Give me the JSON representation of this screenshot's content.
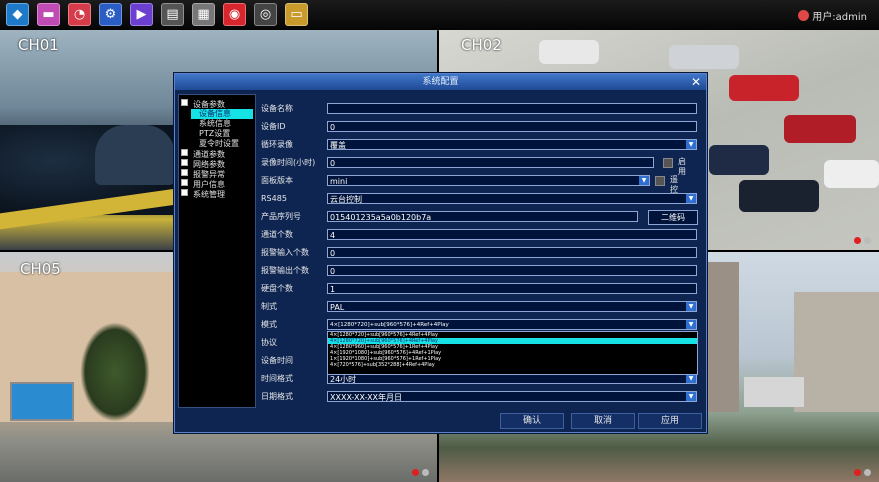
{
  "toolbar": {
    "icons": [
      {
        "name": "logo-icon",
        "glyph": "◆",
        "color": "#1e7ac9"
      },
      {
        "name": "picture-icon",
        "glyph": "▬",
        "color": "#c04bb5"
      },
      {
        "name": "chart-icon",
        "glyph": "◔",
        "color": "#d63b49"
      },
      {
        "name": "settings-icon",
        "glyph": "⚙",
        "color": "#2a5ec4"
      },
      {
        "name": "play-icon",
        "glyph": "▶",
        "color": "#6b3fd0"
      },
      {
        "name": "archive-icon",
        "glyph": "▤",
        "color": "#555555"
      },
      {
        "name": "keyboard-icon",
        "glyph": "▦",
        "color": "#777777"
      },
      {
        "name": "disk-icon",
        "glyph": "◉",
        "color": "#d8262e"
      },
      {
        "name": "camera-icon",
        "glyph": "◎",
        "color": "#444444"
      },
      {
        "name": "folder-icon",
        "glyph": "▭",
        "color": "#c99a2c"
      }
    ],
    "user_label": "用户:admin"
  },
  "cameras": {
    "ch01": "CH01",
    "ch02": "CH02",
    "ch05": "CH05"
  },
  "dialog": {
    "title": "系统配置",
    "tree": {
      "device_params": "设备参数",
      "device_info": "设备信息",
      "system_info": "系统信息",
      "ptz_settings": "PTZ设置",
      "dst_settings": "夏令时设置",
      "channel_params": "通道参数",
      "network_params": "网络参数",
      "alarm_exception": "报警异常",
      "user_info": "用户信息",
      "system_management": "系统管理"
    },
    "fields": {
      "device_name_label": "设备名称",
      "device_name_value": "",
      "device_id_label": "设备ID",
      "device_id_value": "0",
      "loop_record_label": "循环录像",
      "loop_record_value": "覆盖",
      "record_time_label": "录像时间(小时)",
      "record_time_value": "0",
      "record_time_enable": "启用",
      "panel_version_label": "面板版本",
      "panel_version_value": "mini",
      "remote_controller": "遥控器",
      "rs485_label": "RS485",
      "rs485_value": "云台控制",
      "serial_label": "产品序列号",
      "serial_value": "015401235a5a0b120b7a",
      "qr_button": "二维码",
      "channels_label": "通道个数",
      "channels_value": "4",
      "alarm_in_label": "报警输入个数",
      "alarm_in_value": "0",
      "alarm_out_label": "报警输出个数",
      "alarm_out_value": "0",
      "hdd_label": "硬盘个数",
      "hdd_value": "1",
      "standard_label": "制式",
      "standard_value": "PAL",
      "mode_label": "模式",
      "mode_value": "4×[1280*720]+sub[960*576]+4Ref+4Play",
      "protocol_label": "协议",
      "device_time_label": "设备时间",
      "time_format_label": "时间格式",
      "time_format_value": "24小时",
      "date_format_label": "日期格式",
      "date_format_value": "XXXX-XX-XX年月日"
    },
    "mode_options": [
      "4×[1280*720]+sub[960*576]+4Ref+4Play",
      "4×[1280*720]+sub[960*576]+4Ref+4Play",
      "4×[1280*960]+sub[960*576]+1Ref+4Play",
      "4×[1920*1080]+sub[960*576]+4Ref+1Play",
      "1×[1920*1080]+sub[960*576]+1Ref+1Play",
      "4×[720*576]+sub[352*288]+4Ref+4Play"
    ],
    "buttons": {
      "ok": "确认",
      "cancel": "取消",
      "apply": "应用"
    }
  }
}
